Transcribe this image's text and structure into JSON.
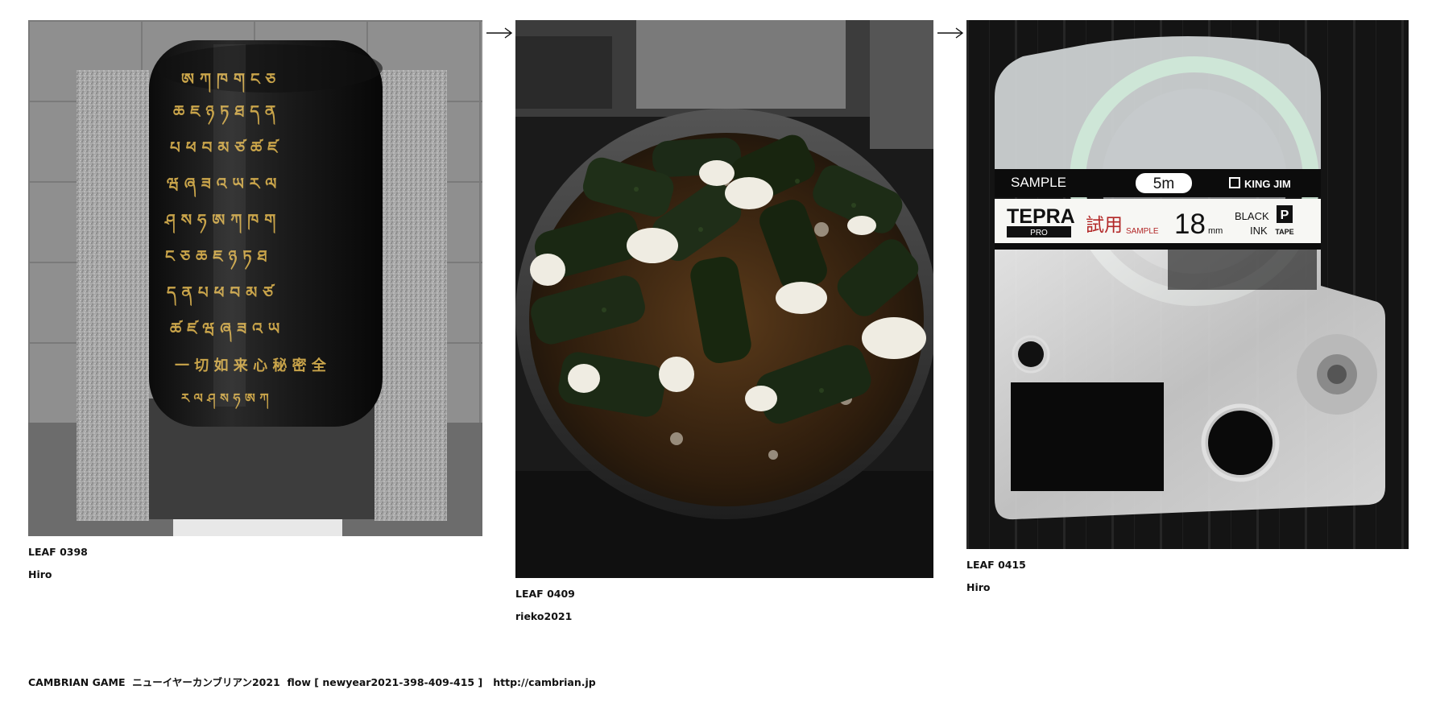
{
  "leaves": [
    {
      "id_label": "LEAF 0398",
      "author": "Hiro",
      "image": "stone-monument-photo"
    },
    {
      "id_label": "LEAF 0409",
      "author": "rieko2021",
      "image": "fried-nori-rolls-photo"
    },
    {
      "id_label": "LEAF 0415",
      "author": "Hiro",
      "image": "label-tape-cassette-photo",
      "cassette_text": {
        "sample": "SAMPLE",
        "length": "5m",
        "maker": "KING JIM",
        "brand": "TEPRA",
        "brand_sub": "PRO",
        "trial": "試用",
        "trial_sample": "SAMPLE",
        "width": "18",
        "width_unit": "mm",
        "ink_line1": "BLACK",
        "ink_line2": "INK",
        "tape_word": "TAPE"
      }
    }
  ],
  "arrows": [
    "arrow-right-icon",
    "arrow-right-icon"
  ],
  "footer": {
    "game": "CAMBRIAN GAME",
    "event": "ニューイヤーカンブリアン2021",
    "flow_label": "flow",
    "flow_id": "[ newyear2021-398-409-415 ]",
    "url": "http://cambrian.jp"
  }
}
